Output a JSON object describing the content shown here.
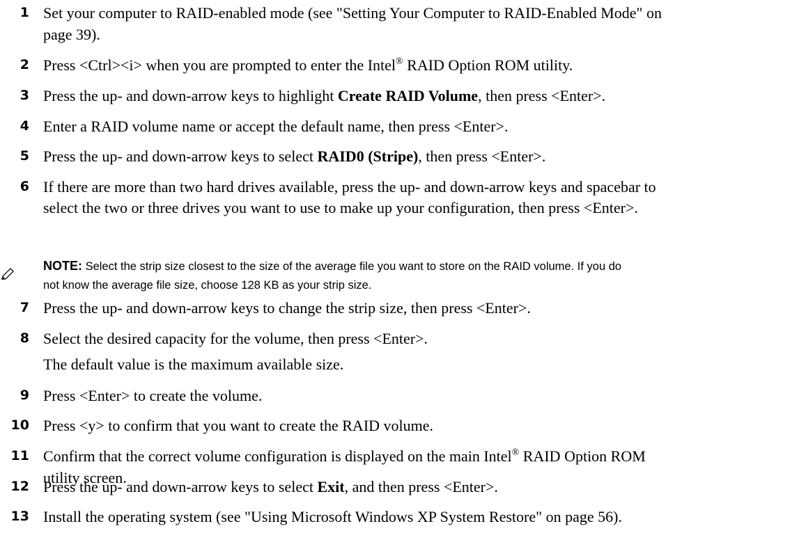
{
  "steps": [
    {
      "num": "1",
      "lines": [
        "Set your computer to RAID-enabled mode (see \"Setting Your Computer to RAID-Enabled Mode\" on",
        "page 39)."
      ]
    },
    {
      "num": "2",
      "pre": "Press <Ctrl><i> when you are prompted to enter the Intel",
      "sup": "®",
      "post": " RAID Option ROM utility."
    },
    {
      "num": "3",
      "pre": "Press the up- and down-arrow keys to highlight ",
      "bold": "Create RAID Volume",
      "post": ", then press <Enter>."
    },
    {
      "num": "4",
      "text": "Enter a RAID volume name or accept the default name, then press <Enter>."
    },
    {
      "num": "5",
      "pre": "Press the up- and down-arrow keys to select ",
      "bold": "RAID0 (Stripe)",
      "post": ", then press <Enter>."
    },
    {
      "num": "6",
      "lines": [
        "If there are more than two hard drives available, press the up- and down-arrow keys and spacebar to",
        "select the two or three drives you want to use to make up your configuration, then press <Enter>."
      ]
    },
    {
      "num": "7",
      "text": "Press the up- and down-arrow keys to change the strip size, then press <Enter>."
    },
    {
      "num": "8",
      "text": "Select the desired capacity for the volume, then press <Enter>.",
      "extra": "The default value is the maximum available size."
    },
    {
      "num": "9",
      "text": "Press <Enter> to create the volume."
    },
    {
      "num": "10",
      "text": "Press <y> to confirm that you want to create the RAID volume."
    },
    {
      "num": "11",
      "pre": "Confirm that the correct volume configuration is displayed on the main Intel",
      "sup": "®",
      "post": " RAID Option ROM",
      "line2": "utility screen."
    },
    {
      "num": "12",
      "pre": "Press the up- and down-arrow keys to select ",
      "bold": "Exit",
      "post": ", and then press <Enter>."
    },
    {
      "num": "13",
      "text": "Install the operating system (see \"Using Microsoft Windows XP System Restore\" on page 56)."
    }
  ],
  "note": {
    "icon": "pencil-note-icon",
    "label": "NOTE:",
    "line1": " Select the strip size closest to the size of the average file you want to store on the RAID volume. If you do",
    "line2": "not know the average file size, choose 128 KB as your strip size."
  }
}
